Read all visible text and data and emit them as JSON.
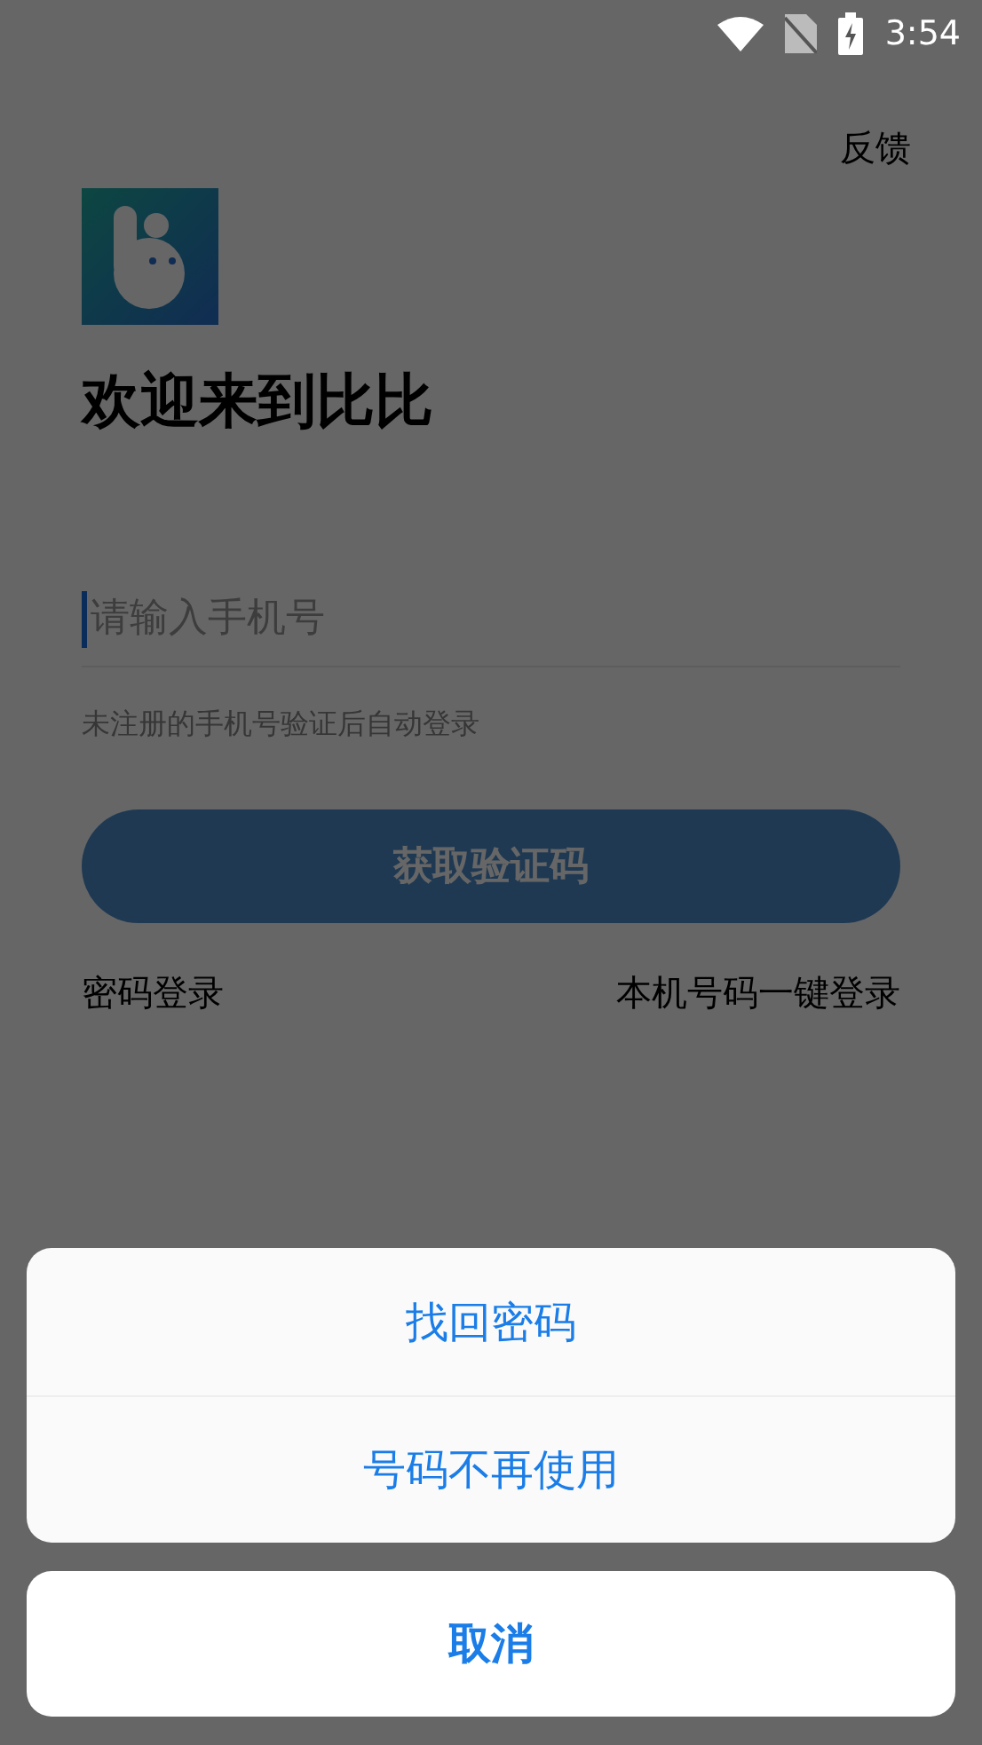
{
  "status_bar": {
    "time": "3:54"
  },
  "header": {
    "feedback": "反馈"
  },
  "title": "欢迎来到比比",
  "phone_field": {
    "placeholder": "请输入手机号"
  },
  "hint": "未注册的手机号验证后自动登录",
  "primary_button": {
    "label": "获取验证码",
    "disabled": true
  },
  "links": [
    "密码登录",
    "本机号码一键登录"
  ],
  "action_sheet": {
    "options": [
      "找回密码",
      "号码不再使用"
    ],
    "cancel": "取消"
  }
}
